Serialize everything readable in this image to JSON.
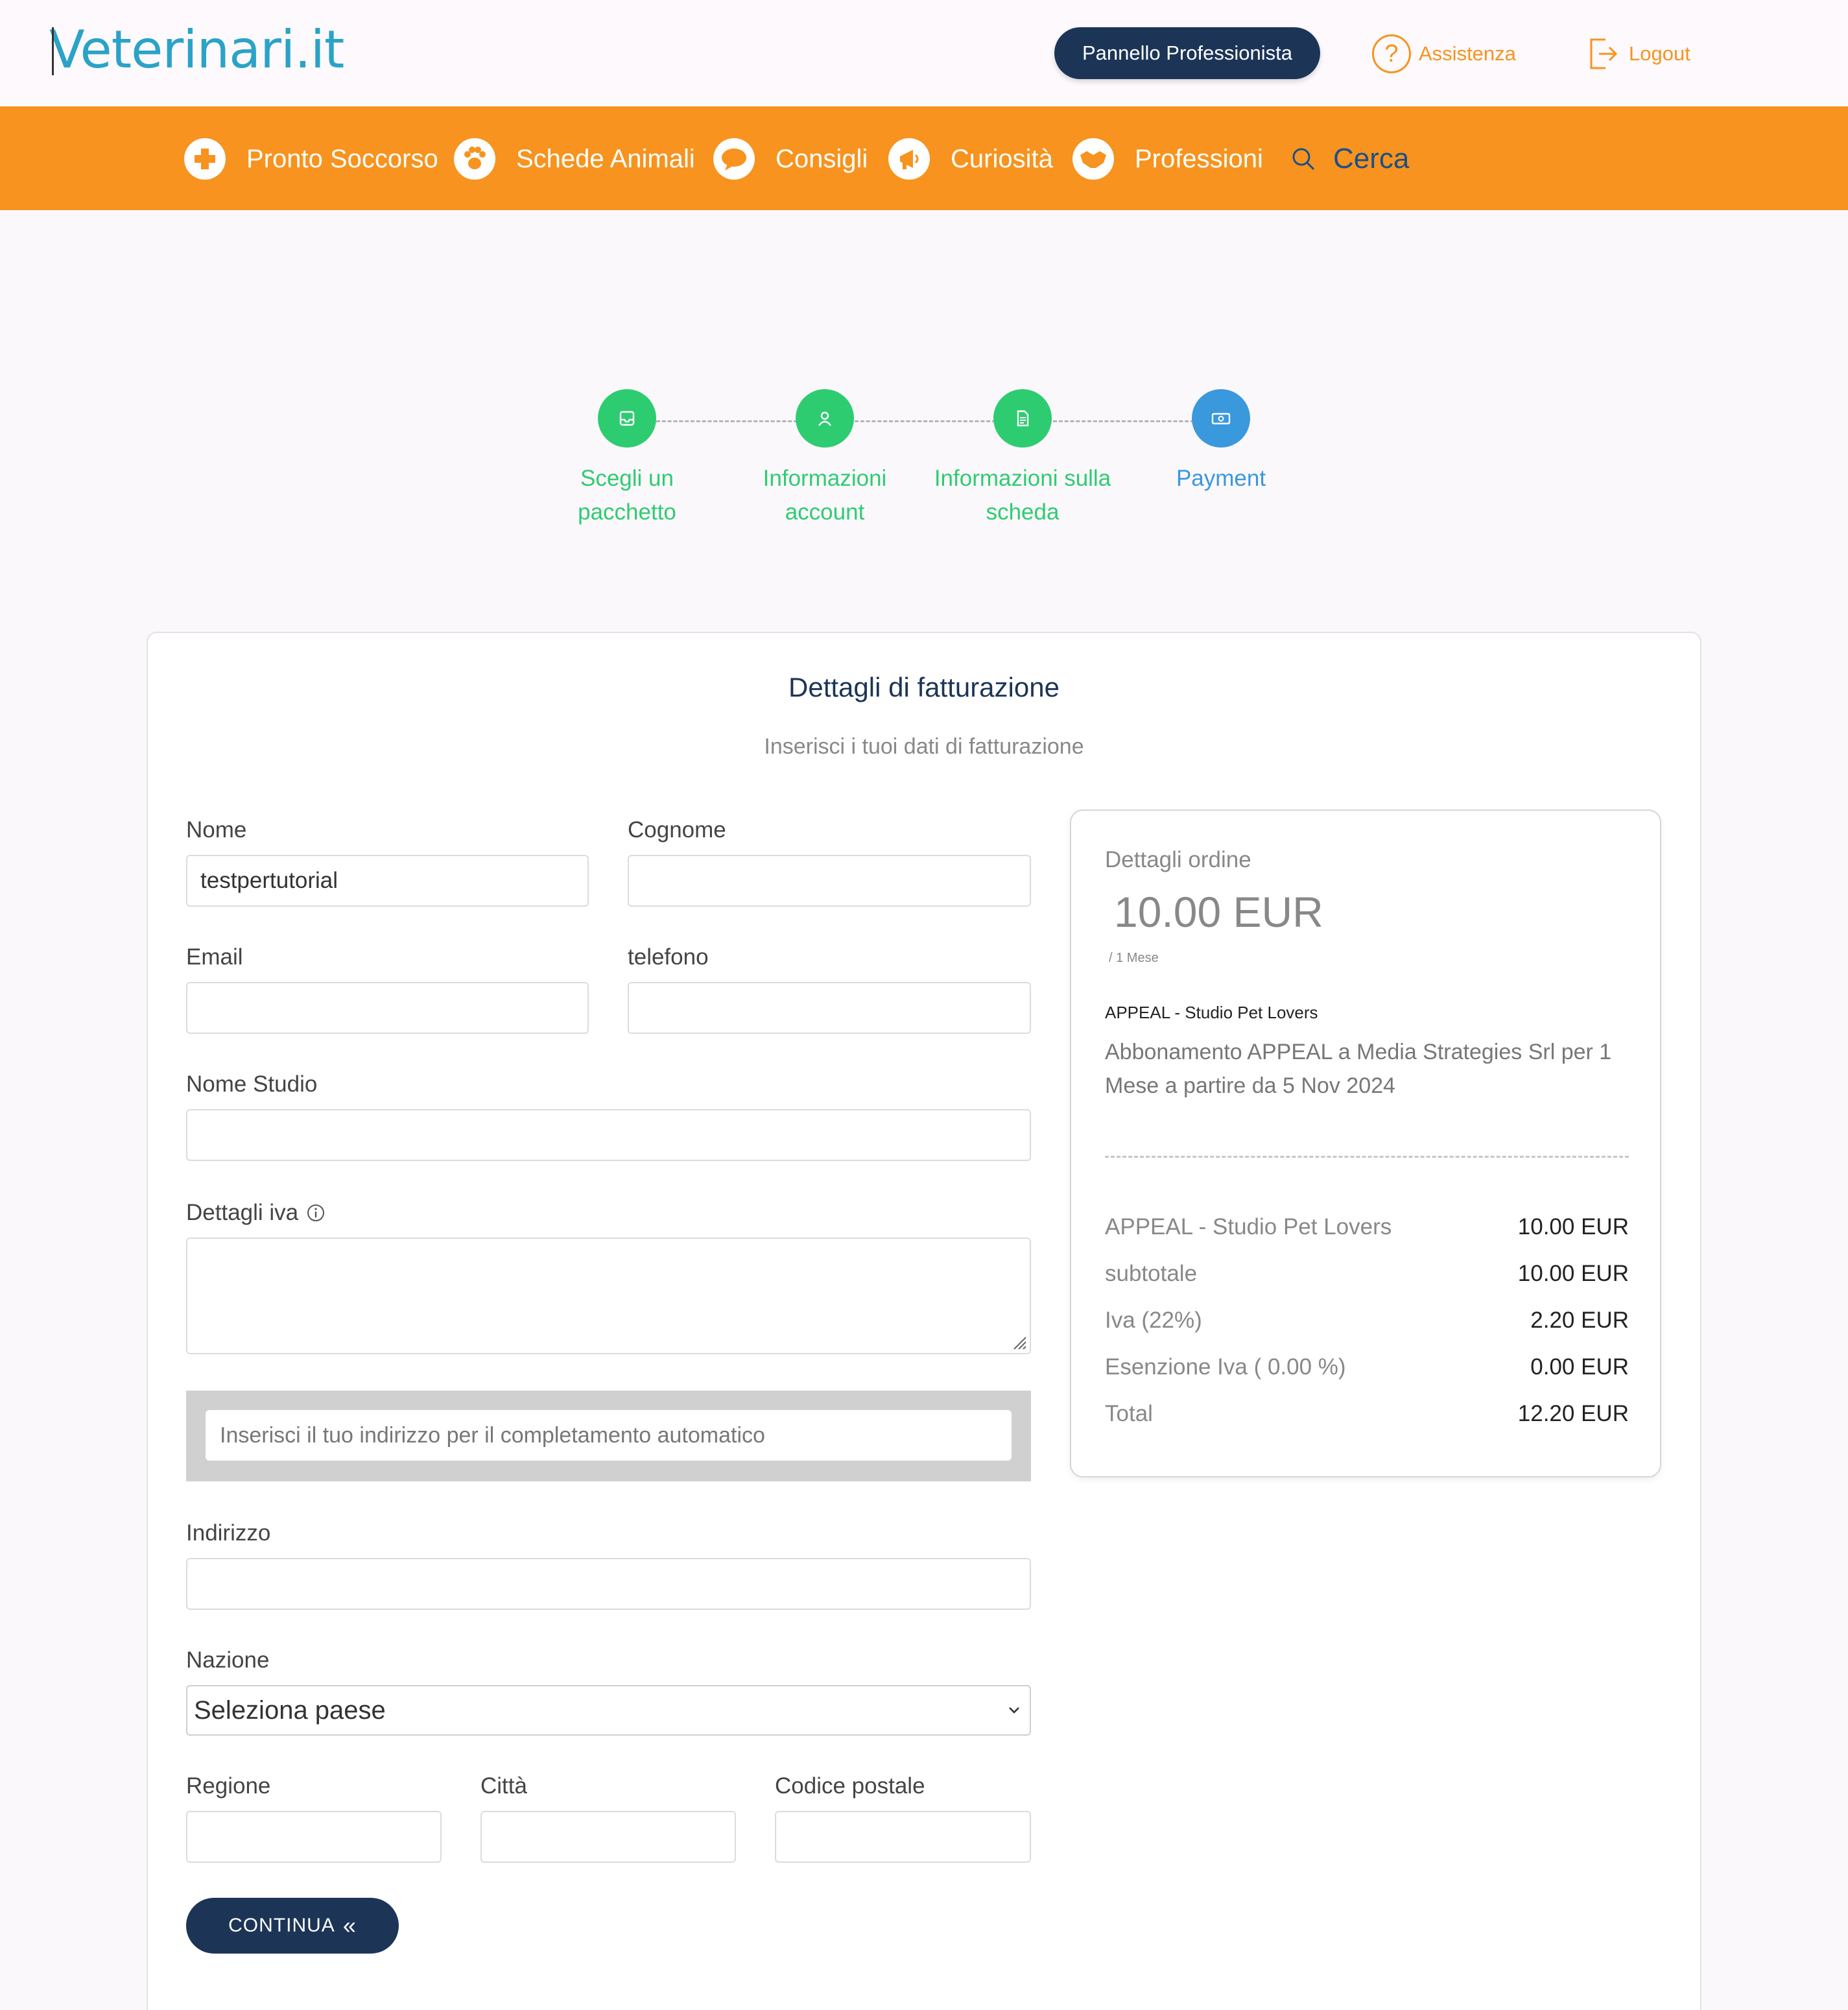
{
  "header": {
    "logo_text": "Veterinari.it",
    "pro_panel_label": "Pannello Professionista",
    "assist_label": "Assistenza",
    "logout_label": "Logout"
  },
  "nav": {
    "items": [
      {
        "label": "Pronto Soccorso",
        "icon": "first-aid-icon"
      },
      {
        "label": "Schede Animali",
        "icon": "paw-icon"
      },
      {
        "label": "Consigli",
        "icon": "chat-bubble-icon"
      },
      {
        "label": "Curiosità",
        "icon": "megaphone-icon"
      },
      {
        "label": "Professioni",
        "icon": "handshake-icon"
      }
    ],
    "search_label": "Cerca"
  },
  "stepper": {
    "steps": [
      {
        "label": "Scegli un pacchetto",
        "status": "done",
        "icon": "inbox-icon"
      },
      {
        "label": "Informazioni account",
        "status": "done",
        "icon": "user-icon"
      },
      {
        "label": "Informazioni sulla scheda",
        "status": "done",
        "icon": "document-icon"
      },
      {
        "label": "Payment",
        "status": "active",
        "icon": "money-icon"
      }
    ]
  },
  "form": {
    "title": "Dettagli di fatturazione",
    "subtitle": "Inserisci i tuoi dati di fatturazione",
    "nome_label": "Nome",
    "nome_value": "testpertutorial",
    "cognome_label": "Cognome",
    "cognome_value": "",
    "email_label": "Email",
    "email_value": "",
    "telefono_label": "telefono",
    "telefono_value": "",
    "studio_label": "Nome Studio",
    "studio_value": "",
    "iva_label": "Dettagli iva",
    "autocomplete_placeholder": "Inserisci il tuo indirizzo per il completamento automatico",
    "indirizzo_label": "Indirizzo",
    "nazione_label": "Nazione",
    "nazione_selected": "Seleziona paese",
    "regione_label": "Regione",
    "citta_label": "Città",
    "cap_label": "Codice postale",
    "continue_label": "CONTINUA"
  },
  "order": {
    "heading": "Dettagli ordine",
    "price": "10.00 EUR",
    "period": "/ 1 Mese",
    "product_name": "APPEAL - Studio Pet Lovers",
    "description": "Abbonamento APPEAL a Media Strategies Srl per 1 Mese a partire da 5 Nov 2024",
    "lines": [
      {
        "label": "APPEAL - Studio Pet Lovers",
        "value": "10.00 EUR"
      },
      {
        "label": "subtotale",
        "value": "10.00 EUR"
      },
      {
        "label": "Iva (22%)",
        "value": "2.20 EUR"
      },
      {
        "label": "Esenzione Iva ( 0.00 %)",
        "value": "0.00 EUR"
      },
      {
        "label": "Total",
        "value": "12.20 EUR"
      }
    ]
  },
  "colors": {
    "brand_orange": "#f7931e",
    "brand_navy": "#1c3557",
    "step_done": "#2ecc71",
    "step_active": "#3a98dd"
  }
}
